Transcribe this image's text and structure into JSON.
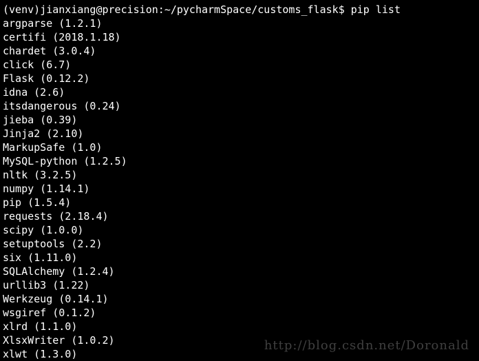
{
  "prompt": {
    "env": "(venv)",
    "user": "jianxiang",
    "at": "@",
    "host": "precision",
    "colon": ":",
    "path": "~/pycharmSpace/customs_flask",
    "dollar": "$ ",
    "command": "pip list"
  },
  "packages": [
    {
      "name": "argparse",
      "version": "1.2.1"
    },
    {
      "name": "certifi",
      "version": "2018.1.18"
    },
    {
      "name": "chardet",
      "version": "3.0.4"
    },
    {
      "name": "click",
      "version": "6.7"
    },
    {
      "name": "Flask",
      "version": "0.12.2"
    },
    {
      "name": "idna",
      "version": "2.6"
    },
    {
      "name": "itsdangerous",
      "version": "0.24"
    },
    {
      "name": "jieba",
      "version": "0.39"
    },
    {
      "name": "Jinja2",
      "version": "2.10"
    },
    {
      "name": "MarkupSafe",
      "version": "1.0"
    },
    {
      "name": "MySQL-python",
      "version": "1.2.5"
    },
    {
      "name": "nltk",
      "version": "3.2.5"
    },
    {
      "name": "numpy",
      "version": "1.14.1"
    },
    {
      "name": "pip",
      "version": "1.5.4"
    },
    {
      "name": "requests",
      "version": "2.18.4"
    },
    {
      "name": "scipy",
      "version": "1.0.0"
    },
    {
      "name": "setuptools",
      "version": "2.2"
    },
    {
      "name": "six",
      "version": "1.11.0"
    },
    {
      "name": "SQLAlchemy",
      "version": "1.2.4"
    },
    {
      "name": "urllib3",
      "version": "1.22"
    },
    {
      "name": "Werkzeug",
      "version": "0.14.1"
    },
    {
      "name": "wsgiref",
      "version": "0.1.2"
    },
    {
      "name": "xlrd",
      "version": "1.1.0"
    },
    {
      "name": "XlsxWriter",
      "version": "1.0.2"
    },
    {
      "name": "xlwt",
      "version": "1.3.0"
    }
  ],
  "watermark": "http://blog.csdn.net/Doronald"
}
